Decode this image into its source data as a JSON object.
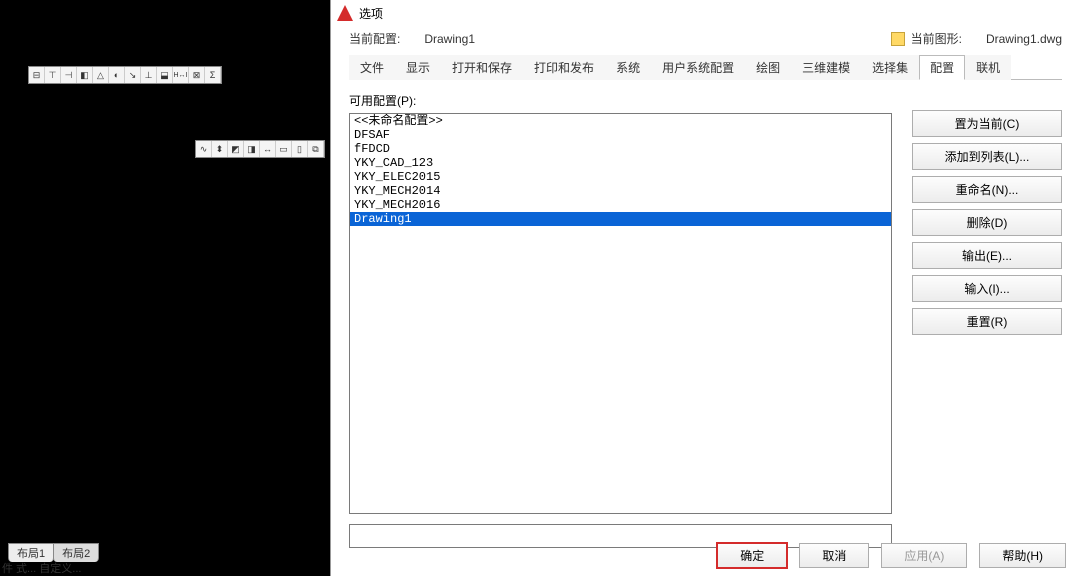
{
  "cad": {
    "layout_tabs": [
      "布局1",
      "布局2"
    ],
    "status": "件 式... 自定义..."
  },
  "dialog": {
    "title": "选项",
    "header": {
      "cur_profile_label": "当前配置:",
      "cur_profile_value": "Drawing1",
      "cur_drawing_label": "当前图形:",
      "cur_drawing_value": "Drawing1.dwg"
    },
    "tabs": [
      "文件",
      "显示",
      "打开和保存",
      "打印和发布",
      "系统",
      "用户系统配置",
      "绘图",
      "三维建模",
      "选择集",
      "配置",
      "联机"
    ],
    "active_tab": "配置",
    "config": {
      "list_label": "可用配置(P):",
      "profiles": [
        {
          "name": "<<未命名配置>>",
          "selected": false
        },
        {
          "name": "DFSAF",
          "selected": false
        },
        {
          "name": "fFDCD",
          "selected": false
        },
        {
          "name": "YKY_CAD_123",
          "selected": false
        },
        {
          "name": "YKY_ELEC2015",
          "selected": false
        },
        {
          "name": "YKY_MECH2014",
          "selected": false
        },
        {
          "name": "YKY_MECH2016",
          "selected": false
        },
        {
          "name": "Drawing1",
          "selected": true
        }
      ],
      "buttons": {
        "set_current": "置为当前(C)",
        "add_to_list": "添加到列表(L)...",
        "rename": "重命名(N)...",
        "delete": "删除(D)",
        "export": "输出(E)...",
        "import": "输入(I)...",
        "reset": "重置(R)"
      }
    },
    "footer": {
      "ok": "确定",
      "cancel": "取消",
      "apply": "应用(A)",
      "help": "帮助(H)"
    }
  }
}
